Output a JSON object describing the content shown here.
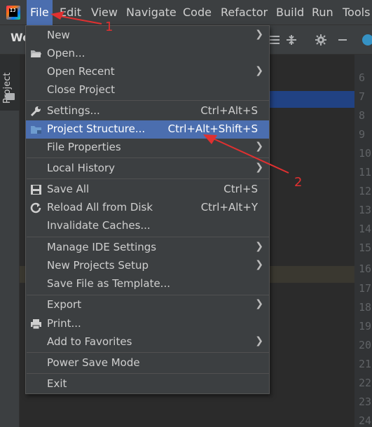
{
  "menubar": {
    "items": [
      "File",
      "Edit",
      "View",
      "Navigate",
      "Code",
      "Refactor",
      "Build",
      "Run",
      "Tools"
    ],
    "logo_text": "IJ"
  },
  "tool_window": {
    "title": "We",
    "stripe_label": "Project"
  },
  "line_numbers": [
    "6",
    "7",
    "8",
    "9",
    "10",
    "11",
    "12",
    "13",
    "14",
    "15",
    "16",
    "17",
    "18",
    "19",
    "20",
    "21",
    "22",
    "23",
    "24"
  ],
  "file_menu": {
    "new": "New",
    "open": "Open...",
    "open_recent": "Open Recent",
    "close_project": "Close Project",
    "settings": "Settings...",
    "settings_shortcut": "Ctrl+Alt+S",
    "project_structure": "Project Structure...",
    "project_structure_shortcut": "Ctrl+Alt+Shift+S",
    "file_properties": "File Properties",
    "local_history": "Local History",
    "save_all": "Save All",
    "save_all_shortcut": "Ctrl+S",
    "reload_all": "Reload All from Disk",
    "reload_all_shortcut": "Ctrl+Alt+Y",
    "invalidate_caches": "Invalidate Caches...",
    "manage_ide_settings": "Manage IDE Settings",
    "new_projects_setup": "New Projects Setup",
    "save_as_template": "Save File as Template...",
    "export": "Export",
    "print": "Print...",
    "add_to_favorites": "Add to Favorites",
    "power_save_mode": "Power Save Mode",
    "exit": "Exit"
  },
  "annotations": {
    "one": "1",
    "two": "2"
  },
  "colors": {
    "selection": "#4b6eaf",
    "annotation": "#e03030"
  }
}
